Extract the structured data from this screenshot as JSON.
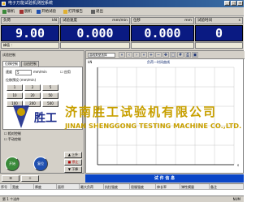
{
  "window": {
    "title": "电子万能试验机测控系统"
  },
  "menu": {
    "items": [
      "联机",
      "脱机",
      "开始试验",
      "打开报告",
      "退出"
    ]
  },
  "meters": [
    {
      "label": "负荷",
      "unit": "kN",
      "value": "9.00",
      "foot": "峰值 ："
    },
    {
      "label": "试验速度",
      "unit": "mm/min",
      "value": "0.000",
      "foot": ""
    },
    {
      "label": "位移",
      "unit": "mm",
      "value": "0.000",
      "foot": ""
    },
    {
      "label": "试验时间",
      "unit": "s",
      "value": "0",
      "foot": ""
    }
  ],
  "left": {
    "title": "试验控制",
    "tabs": [
      "位移控制",
      "自由控制"
    ],
    "speed_label": "速度",
    "speed_value": "5",
    "speed_unit": "mm/min",
    "apply_label": "应用",
    "preset_title": "位移预设 (mm/min)",
    "presets": [
      "1",
      "2",
      "5",
      "10",
      "20",
      "50",
      "100",
      "200",
      "500"
    ],
    "check1": "相对控制",
    "check2": "手动控制",
    "up_label": "上升",
    "stop_label": "停止",
    "down_label": "下降",
    "run_label": "开始",
    "reset_label": "复位"
  },
  "chart": {
    "selector": "曲线类型选择",
    "title": "负荷—时间曲线",
    "ylabel": "kN",
    "xlabel": "s"
  },
  "bottom": {
    "bar_title": "试 件 信 息",
    "columns": [
      "序号",
      "宽度",
      "厚度",
      "面积",
      "最大负荷",
      "抗拉强度",
      "屈服强度",
      "伸长率",
      "弹性模量",
      "备注"
    ]
  },
  "watermark": {
    "cn": "济南胜工试验机有限公司",
    "en": "JINAN SHENGGONG TESTING MACHINE CO.,LTD.",
    "logo_char": "胜工"
  },
  "status": {
    "text": "第 1 个试件",
    "right": "NUM"
  },
  "colors": {
    "display_bg": "#0a1a82",
    "title_bg": "#0a246a",
    "bar_bg": "#0a46c8",
    "watermark": "#c8a000"
  }
}
